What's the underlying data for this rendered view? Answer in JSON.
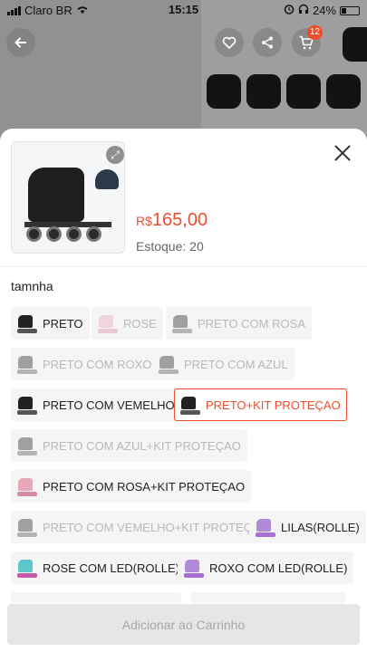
{
  "status_bar": {
    "carrier": "Claro BR",
    "time": "15:15",
    "battery": "24%"
  },
  "background": {
    "cart_badge": "12"
  },
  "product": {
    "currency": "R$",
    "price": "165,00",
    "stock_label": "Estoque: 20"
  },
  "variation": {
    "title": "tamnha",
    "options": [
      {
        "label": "PRETO",
        "state": "available",
        "icon": "skate-black-thumb"
      },
      {
        "label": "ROSE",
        "state": "disabled",
        "icon": "skate-pink-thumb"
      },
      {
        "label": "PRETO COM ROSA",
        "state": "disabled",
        "icon": "skate-black-pink-thumb"
      },
      {
        "label": "PRETO COM ROXO",
        "state": "disabled",
        "icon": "skate-black-purple-thumb"
      },
      {
        "label": "PRETO COM AZUL",
        "state": "disabled",
        "icon": "skate-black-blue-thumb"
      },
      {
        "label": "PRETO COM VEMELHO",
        "state": "available",
        "icon": "skate-black-red-thumb"
      },
      {
        "label": "PRETO+KIT PROTEÇAO",
        "state": "selected",
        "icon": "skate-kit-thumb"
      },
      {
        "label": "PRETO COM AZUL+KIT PROTEÇAO",
        "state": "disabled",
        "icon": "skate-blue-kit-thumb"
      },
      {
        "label": "PRETO COM ROSA+KIT PROTEÇAO",
        "state": "available",
        "icon": "skate-pink-kit-thumb"
      },
      {
        "label": "PRETO COM VEMELHO+KIT PROTEÇA",
        "state": "disabled",
        "icon": "skate-red-kit-thumb"
      },
      {
        "label": "LILAS(ROLLE)",
        "state": "available",
        "icon": "skate-lilac-thumb"
      },
      {
        "label": "ROSE COM LED(ROLLE)",
        "state": "available",
        "icon": "skate-rose-led-thumb"
      },
      {
        "label": "ROXO COM LED(ROLLE)",
        "state": "available",
        "icon": "skate-purple-led-thumb"
      }
    ]
  },
  "add_to_cart": {
    "label": "Adicionar ao Carrinho"
  },
  "colors": {
    "accent": "#ee4d2d",
    "disabled_text": "#b9b9b9",
    "chip_bg": "#f5f5f5"
  }
}
